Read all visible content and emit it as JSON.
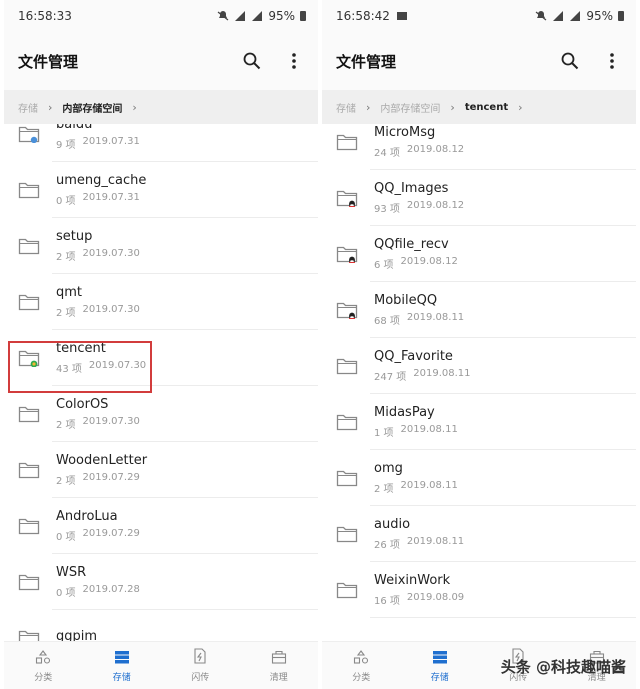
{
  "colors": {
    "accent": "#1f6fcf",
    "highlight": "#d23c3c",
    "folder": "#888888"
  },
  "left": {
    "status": {
      "time": "16:58:33",
      "battery": "95%"
    },
    "title": "文件管理",
    "breadcrumb": {
      "root": "存储",
      "current": "内部存储空间"
    },
    "files": [
      {
        "name": "baidu",
        "count": "9 项",
        "date": "2019.07.31",
        "badge": "app"
      },
      {
        "name": "umeng_cache",
        "count": "0 项",
        "date": "2019.07.31",
        "badge": ""
      },
      {
        "name": "setup",
        "count": "2 项",
        "date": "2019.07.30",
        "badge": ""
      },
      {
        "name": "qmt",
        "count": "2 项",
        "date": "2019.07.30",
        "badge": ""
      },
      {
        "name": "tencent",
        "count": "43 项",
        "date": "2019.07.30",
        "badge": "tencent"
      },
      {
        "name": "ColorOS",
        "count": "2 项",
        "date": "2019.07.30",
        "badge": ""
      },
      {
        "name": "WoodenLetter",
        "count": "2 项",
        "date": "2019.07.29",
        "badge": ""
      },
      {
        "name": "AndroLua",
        "count": "0 项",
        "date": "2019.07.29",
        "badge": ""
      },
      {
        "name": "WSR",
        "count": "0 项",
        "date": "2019.07.28",
        "badge": ""
      },
      {
        "name": "ggpim",
        "count": "",
        "date": "",
        "badge": ""
      }
    ],
    "nav": [
      {
        "label": "分类",
        "icon": "category-icon",
        "active": false
      },
      {
        "label": "存储",
        "icon": "storage-icon",
        "active": true
      },
      {
        "label": "闪传",
        "icon": "transfer-icon",
        "active": false
      },
      {
        "label": "清理",
        "icon": "clean-icon",
        "active": false
      }
    ]
  },
  "right": {
    "status": {
      "time": "16:58:42",
      "battery": "95%"
    },
    "title": "文件管理",
    "breadcrumb": {
      "root": "存储",
      "middle": "内部存储空间",
      "current": "tencent"
    },
    "files": [
      {
        "name": "MicroMsg",
        "count": "24 项",
        "date": "2019.08.12",
        "badge": ""
      },
      {
        "name": "QQ_Images",
        "count": "93 项",
        "date": "2019.08.12",
        "badge": "qq"
      },
      {
        "name": "QQfile_recv",
        "count": "6 项",
        "date": "2019.08.12",
        "badge": "qq"
      },
      {
        "name": "MobileQQ",
        "count": "68 项",
        "date": "2019.08.11",
        "badge": "qq"
      },
      {
        "name": "QQ_Favorite",
        "count": "247 项",
        "date": "2019.08.11",
        "badge": ""
      },
      {
        "name": "MidasPay",
        "count": "1 项",
        "date": "2019.08.11",
        "badge": ""
      },
      {
        "name": "omg",
        "count": "2 项",
        "date": "2019.08.11",
        "badge": ""
      },
      {
        "name": "audio",
        "count": "26 项",
        "date": "2019.08.11",
        "badge": ""
      },
      {
        "name": "WeixinWork",
        "count": "16 项",
        "date": "2019.08.09",
        "badge": ""
      }
    ],
    "nav": [
      {
        "label": "分类",
        "icon": "category-icon",
        "active": false
      },
      {
        "label": "存储",
        "icon": "storage-icon",
        "active": true
      },
      {
        "label": "闪传",
        "icon": "transfer-icon",
        "active": false
      },
      {
        "label": "清理",
        "icon": "clean-icon",
        "active": false
      }
    ]
  },
  "watermark": "头条 @科技趣喵酱"
}
